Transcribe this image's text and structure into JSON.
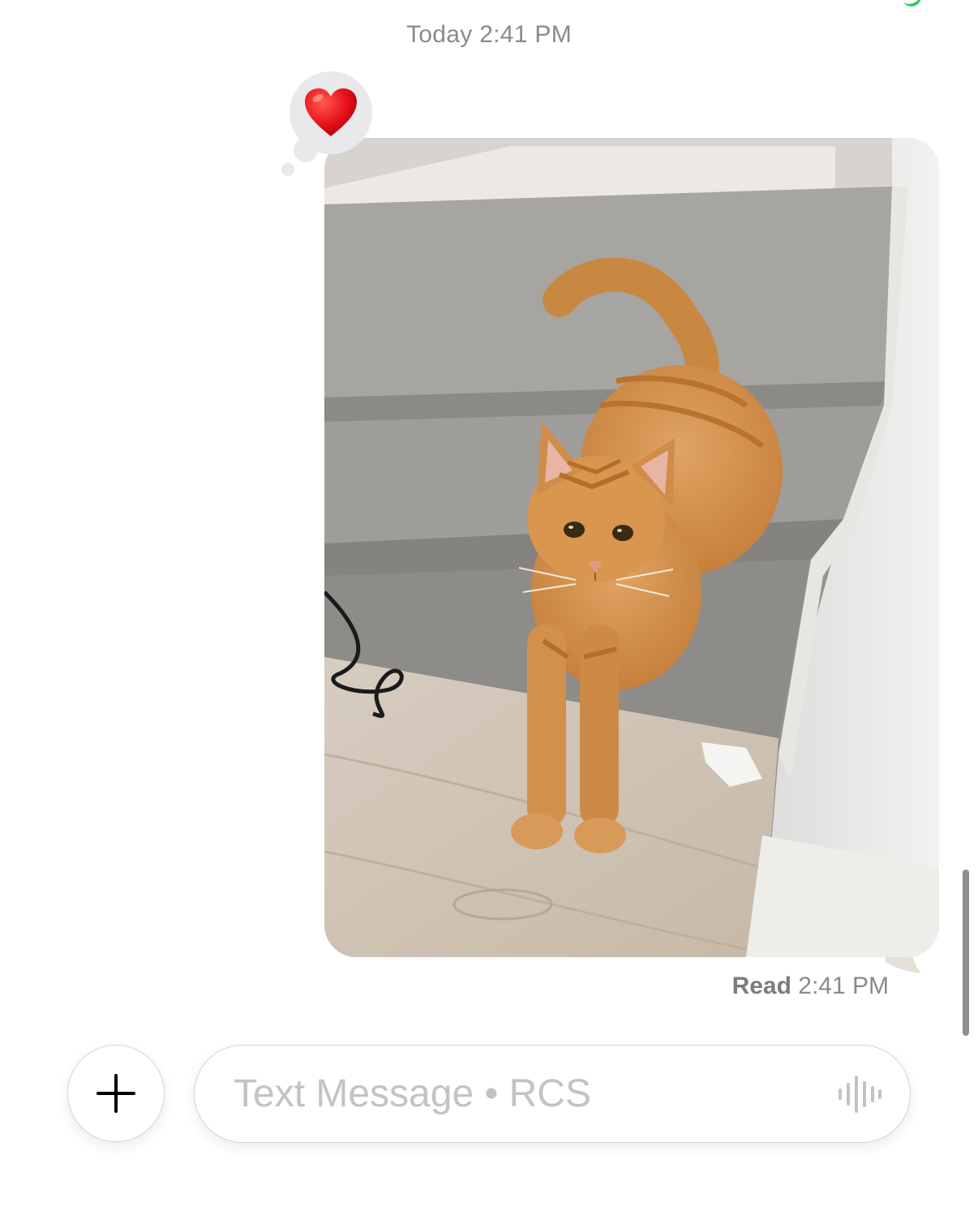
{
  "conversation": {
    "timestamp_day": "Today",
    "timestamp_time": "2:41 PM"
  },
  "message": {
    "tapback_emoji": "❤️",
    "tapback_icon": "heart-icon",
    "attachment": "photo of orange tabby cat on carpeted stairs",
    "status_label": "Read",
    "status_time": "2:41 PM"
  },
  "composer": {
    "add_icon": "plus-icon",
    "placeholder": "Text Message • RCS",
    "value": "",
    "dictation_icon": "waveform-icon"
  },
  "colors": {
    "accent_green": "#34c759",
    "tapback_bg": "#e9e9eb",
    "timestamp_gray": "#8a8a8e"
  }
}
